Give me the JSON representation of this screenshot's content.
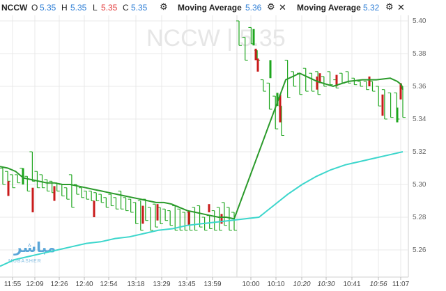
{
  "legend": {
    "symbol": "NCCW",
    "o_label": "O",
    "o_value": "5.35",
    "h_label": "H",
    "h_value": "5.35",
    "l_label": "L",
    "l_value": "5.35",
    "c_label": "C",
    "c_value": "5.35",
    "ma1_label": "Moving Average",
    "ma1_value": "5.36",
    "ma2_label": "Moving Average",
    "ma2_value": "5.32"
  },
  "watermark": "NCCW | 5.35",
  "logo": {
    "ar": "مباشر",
    "en": "MUBASHER"
  },
  "colors": {
    "up": "#1ca51c",
    "down": "#c91b1b",
    "ma_fast": "#2a9a2a",
    "ma_slow": "#3cd6cc",
    "grid": "#e8e8e8",
    "accent": "#2f7fd6"
  },
  "chart_data": {
    "type": "line",
    "title": "",
    "ylim": [
      5.25,
      5.4
    ],
    "yticks": [
      "5.40",
      "5.38",
      "5.36",
      "5.34",
      "5.32",
      "5.30",
      "5.28",
      "5.26"
    ],
    "xticks": [
      {
        "label": "11:55",
        "italic": false
      },
      {
        "label": "12:09",
        "italic": false
      },
      {
        "label": "12:26",
        "italic": false
      },
      {
        "label": "12:40",
        "italic": false
      },
      {
        "label": "12:54",
        "italic": false
      },
      {
        "label": "13:18",
        "italic": false
      },
      {
        "label": "13:29",
        "italic": false
      },
      {
        "label": "13:45",
        "italic": false
      },
      {
        "label": "13:59",
        "italic": false
      },
      {
        "label": "10:00",
        "italic": false
      },
      {
        "label": "10:10",
        "italic": false
      },
      {
        "label": "10:20",
        "italic": true
      },
      {
        "label": "10:30",
        "italic": true
      },
      {
        "label": "10:41",
        "italic": false
      },
      {
        "label": "10:56",
        "italic": true
      },
      {
        "label": "11:07",
        "italic": false
      }
    ],
    "grid": true,
    "price_bars": [
      [
        5.31,
        5.3
      ],
      [
        5.308,
        5.302
      ],
      [
        5.306,
        5.298
      ],
      [
        5.306,
        5.301
      ],
      [
        5.31,
        5.304
      ],
      [
        5.305,
        5.296
      ],
      [
        5.32,
        5.302
      ],
      [
        5.308,
        5.298
      ],
      [
        5.306,
        5.298
      ],
      [
        5.303,
        5.296
      ],
      [
        5.302,
        5.295
      ],
      [
        5.301,
        5.296
      ],
      [
        5.3,
        5.293
      ],
      [
        5.298,
        5.291
      ],
      [
        5.306,
        5.286
      ],
      [
        5.3,
        5.294
      ],
      [
        5.298,
        5.292
      ],
      [
        5.296,
        5.291
      ],
      [
        5.296,
        5.29
      ],
      [
        5.295,
        5.29
      ],
      [
        5.294,
        5.289
      ],
      [
        5.292,
        5.286
      ],
      [
        5.294,
        5.287
      ],
      [
        5.292,
        5.285
      ],
      [
        5.296,
        5.285
      ],
      [
        5.292,
        5.284
      ],
      [
        5.291,
        5.283
      ],
      [
        5.289,
        5.276
      ],
      [
        5.29,
        5.272
      ],
      [
        5.291,
        5.278
      ],
      [
        5.286,
        5.272
      ],
      [
        5.288,
        5.274
      ],
      [
        5.286,
        5.276
      ],
      [
        5.285,
        5.278
      ],
      [
        5.284,
        5.275
      ],
      [
        5.287,
        5.272
      ],
      [
        5.285,
        5.272
      ],
      [
        5.283,
        5.272
      ],
      [
        5.283,
        5.272
      ],
      [
        5.286,
        5.272
      ],
      [
        5.287,
        5.274
      ],
      [
        5.28,
        5.272
      ],
      [
        5.281,
        5.273
      ],
      [
        5.284,
        5.272
      ],
      [
        5.286,
        5.272
      ],
      [
        5.289,
        5.275
      ],
      [
        5.286,
        5.272
      ],
      [
        5.283,
        5.272
      ],
      [
        5.4,
        5.385
      ],
      [
        5.39,
        5.376
      ],
      [
        5.396,
        5.386
      ],
      [
        5.382,
        5.376
      ],
      [
        5.364,
        5.357
      ],
      [
        5.362,
        5.346
      ],
      [
        5.354,
        5.334
      ],
      [
        5.348,
        5.33
      ],
      [
        5.376,
        5.353
      ],
      [
        5.369,
        5.36
      ],
      [
        5.368,
        5.355
      ],
      [
        5.371,
        5.357
      ],
      [
        5.368,
        5.357
      ],
      [
        5.369,
        5.355
      ],
      [
        5.366,
        5.36
      ],
      [
        5.369,
        5.361
      ],
      [
        5.364,
        5.359
      ],
      [
        5.368,
        5.362
      ],
      [
        5.369,
        5.362
      ],
      [
        5.365,
        5.361
      ],
      [
        5.363,
        5.36
      ],
      [
        5.363,
        5.358
      ],
      [
        5.363,
        5.357
      ],
      [
        5.36,
        5.348
      ],
      [
        5.358,
        5.34
      ],
      [
        5.356,
        5.341
      ],
      [
        5.356,
        5.34
      ],
      [
        5.36,
        5.341
      ]
    ],
    "down_bars": [
      [
        5.302,
        5.293
      ],
      [
        5.298,
        5.283
      ],
      [
        5.299,
        5.29
      ],
      [
        5.29,
        5.28
      ],
      [
        5.287,
        5.276
      ],
      [
        5.288,
        5.278
      ],
      [
        5.284,
        5.275
      ],
      [
        5.288,
        5.283
      ],
      [
        5.282,
        5.276
      ],
      [
        5.383,
        5.376
      ],
      [
        5.377,
        5.369
      ],
      [
        5.355,
        5.338
      ],
      [
        5.368,
        5.362
      ],
      [
        5.366,
        5.358
      ],
      [
        5.367,
        5.36
      ],
      [
        5.366,
        5.36
      ],
      [
        5.355,
        5.342
      ],
      [
        5.362,
        5.352
      ]
    ],
    "up_bars": [
      [
        5.31,
        5.3
      ],
      [
        5.395,
        5.385
      ],
      [
        5.376,
        5.365
      ],
      [
        5.356,
        5.348
      ],
      [
        5.347,
        5.338
      ]
    ],
    "series": [
      {
        "values": [
          5.311,
          5.31,
          5.308,
          5.304,
          5.303,
          5.302,
          5.301,
          5.301,
          5.3,
          5.3,
          5.299,
          5.298,
          5.297,
          5.296,
          5.295,
          5.294,
          5.293,
          5.292,
          5.291,
          5.29,
          5.289,
          5.289,
          5.288,
          5.286,
          5.284,
          5.283,
          5.282,
          5.281,
          5.28,
          5.28,
          5.279,
          5.364,
          5.368,
          5.363,
          5.36,
          5.363,
          5.364,
          5.364,
          5.365,
          5.363,
          5.361,
          5.358
        ]
      },
      {
        "values": [
          5.25,
          5.254,
          5.256,
          5.258,
          5.26,
          5.262,
          5.264,
          5.265,
          5.267,
          5.268,
          5.27,
          5.272,
          5.273,
          5.275,
          5.276,
          5.277,
          5.278,
          5.279,
          5.28,
          5.287,
          5.294,
          5.3,
          5.305,
          5.309,
          5.312,
          5.314,
          5.316,
          5.318,
          5.32
        ]
      }
    ]
  }
}
